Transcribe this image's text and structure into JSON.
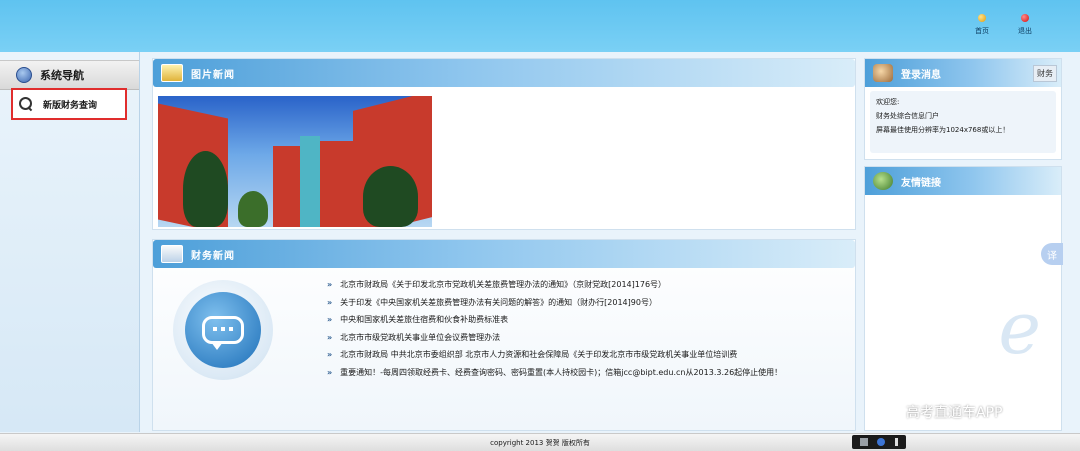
{
  "header": {
    "nav": [
      {
        "label": "首页",
        "icon": "home-dot-icon"
      },
      {
        "label": "退出",
        "icon": "exit-dot-icon"
      }
    ]
  },
  "sidebar": {
    "title": "系统导航",
    "items": [
      {
        "label": "新版财务查询"
      }
    ]
  },
  "picture_news": {
    "title": "图片新闻"
  },
  "finance_news": {
    "title": "财务新闻",
    "items": [
      "北京市财政局《关于印发北京市党政机关差旅费管理办法的通知》（京财党政[2014]176号）",
      "关于印发《中央国家机关差旅费管理办法有关问题的解答》的通知（财办行[2014]90号）",
      "中央和国家机关差旅住宿费和伙食补助费标准表",
      "北京市市级党政机关事业单位会议费管理办法",
      "北京市财政局 中共北京市委组织部 北京市人力资源和社会保障局《关于印发北京市市级党政机关事业单位培训费",
      "重要通知！-每周四领取经费卡、经费查询密码、密码重置(本人持校园卡)；信箱jcc@bipt.edu.cn从2013.3.26起停止使用！"
    ]
  },
  "login_panel": {
    "title": "登录消息",
    "mini_tab": "财务",
    "lines": [
      "欢迎您:",
      "财务处综合信息门户",
      "屏幕最佳使用分辨率为1024x768或以上！"
    ]
  },
  "links_panel": {
    "title": "友情链接"
  },
  "translate_label": "译",
  "watermark": "高考直通车APP",
  "footer": {
    "copyright": "copyright 2013 贺贺 版权所有"
  },
  "colors": {
    "header": "#66c6f2",
    "panel_head": "#4d9fd9",
    "highlight_border": "#e02d2d"
  }
}
